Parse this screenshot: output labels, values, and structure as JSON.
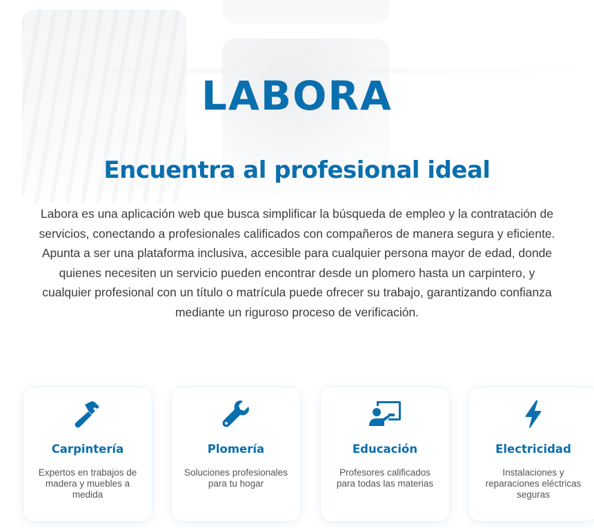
{
  "hero": {
    "brand": "LABORA",
    "headline": "Encuentra al profesional ideal",
    "description": "Labora es una aplicación web que busca simplificar la búsqueda de empleo y la contratación de servicios, conectando a profesionales calificados con compañeros de manera segura y eficiente. Apunta a ser una plataforma inclusiva, accesible para cualquier persona mayor de edad, donde quienes necesiten un servicio pueden encontrar desde un plomero hasta un carpintero, y cualquier profesional con un título o matrícula puede ofrecer su trabajo, garantizando confianza mediante un riguroso proceso de verificación."
  },
  "categories": [
    {
      "icon": "hammer-icon",
      "title": "Carpintería",
      "text": "Expertos en trabajos de madera y muebles a medida"
    },
    {
      "icon": "wrench-icon",
      "title": "Plomería",
      "text": "Soluciones profesionales para tu hogar"
    },
    {
      "icon": "teacher-board-icon",
      "title": "Educación",
      "text": "Profesores calificados para todas las materias"
    },
    {
      "icon": "lightning-bolt-icon",
      "title": "Electricidad",
      "text": "Instalaciones y reparaciones eléctricas seguras"
    }
  ],
  "colors": {
    "accent": "#0a6fae",
    "body_text": "#3b3b3b",
    "card_text": "#555555"
  }
}
